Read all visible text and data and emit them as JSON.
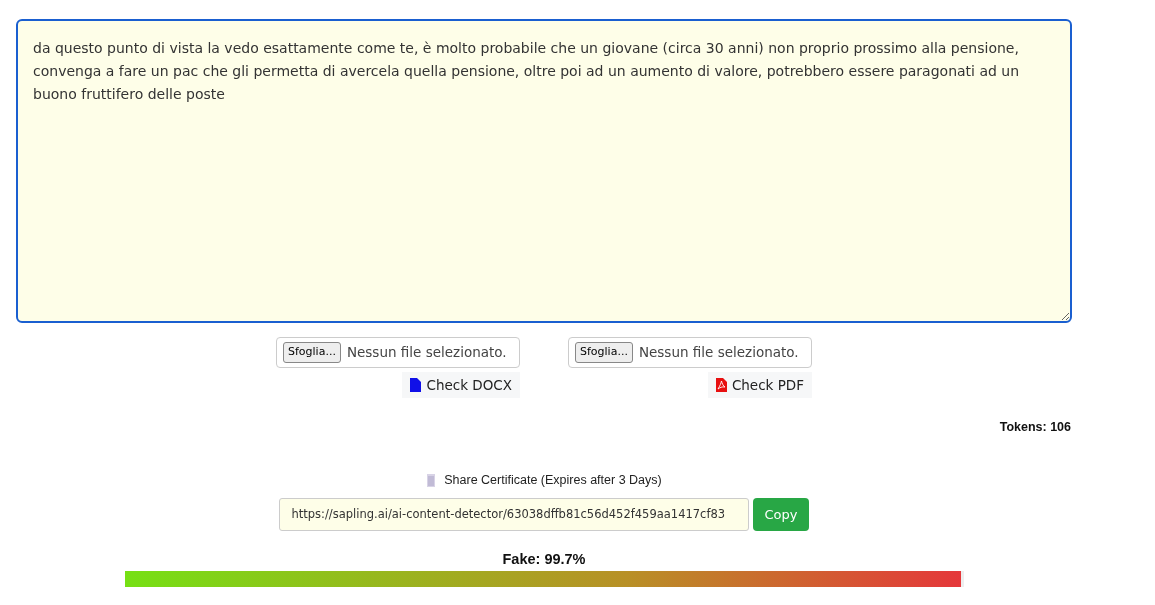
{
  "editor": {
    "value": "da questo punto di vista la vedo esattamente come te, è molto probabile che un giovane (circa 30 anni) non proprio prossimo alla pensione, convenga a fare un pac che gli permetta di avercela quella pensione, oltre poi ad un aumento di valore, potrebbero essere paragonati ad un buono fruttifero delle poste",
    "focused": true
  },
  "uploads": [
    {
      "kind": "docx",
      "browse_label": "Sfoglia...",
      "file_status": "Nessun file selezionato.",
      "check_label": "Check DOCX"
    },
    {
      "kind": "pdf",
      "browse_label": "Sfoglia...",
      "file_status": "Nessun file selezionato.",
      "check_label": "Check PDF"
    }
  ],
  "tokens": "Tokens: 106",
  "share": {
    "label": "Share Certificate (Expires after 3 Days)",
    "url": "https://sapling.ai/ai-content-detector/63038dffb81c56d452f459aa1417cf83",
    "copy_label": "Copy"
  },
  "result": {
    "label": "Fake: 99.7%",
    "level": 0.997
  }
}
